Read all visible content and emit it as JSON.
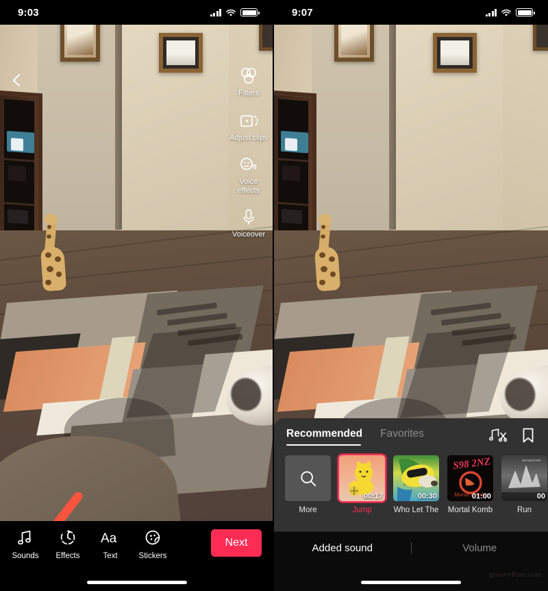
{
  "meta": {
    "watermark": "groovyPost.com"
  },
  "left_phone": {
    "status": {
      "time": "9:03",
      "signal_icon": "cellular-bars-icon",
      "wifi_icon": "wifi-icon",
      "battery_icon": "battery-icon"
    },
    "back_icon": "back-chevron-icon",
    "tools": [
      {
        "label": "Filters",
        "icon": "filters-icon"
      },
      {
        "label": "Adjust clips",
        "icon": "adjust-clips-icon"
      },
      {
        "label": "Voice effects",
        "icon": "voice-effects-icon"
      },
      {
        "label": "Voiceover",
        "icon": "microphone-icon"
      }
    ],
    "actions": [
      {
        "label": "Sounds",
        "icon": "music-note-icon"
      },
      {
        "label": "Effects",
        "icon": "effects-clock-icon"
      },
      {
        "label": "Text",
        "icon": "text-aa-icon"
      },
      {
        "label": "Stickers",
        "icon": "sticker-face-icon"
      }
    ],
    "next_label": "Next",
    "next_color": "#fe2c55",
    "annotation": {
      "icon": "red-arrow-icon",
      "color": "#f9543f",
      "points_to": "Sounds"
    }
  },
  "right_phone": {
    "status": {
      "time": "9:07",
      "signal_icon": "cellular-bars-icon",
      "wifi_icon": "wifi-icon",
      "battery_icon": "battery-icon"
    },
    "sound_panel": {
      "tabs": [
        {
          "label": "Recommended",
          "active": true
        },
        {
          "label": "Favorites",
          "active": false
        }
      ],
      "icons": [
        {
          "name": "trim-sound-icon"
        },
        {
          "name": "bookmark-icon"
        }
      ],
      "sounds": [
        {
          "name": "More",
          "duration": "",
          "selected": false,
          "art": "search"
        },
        {
          "name": "Jump",
          "duration": "00:17",
          "selected": true,
          "art": "cat"
        },
        {
          "name": "Who Let The",
          "duration": "00:30",
          "selected": false,
          "art": "dog"
        },
        {
          "name": "Mortal Komb",
          "duration": "01:00",
          "selected": false,
          "art": "mk"
        },
        {
          "name": "Run",
          "duration": "00",
          "selected": false,
          "art": "mono"
        }
      ],
      "bottom_tabs": [
        {
          "label": "Added sound",
          "active": true
        },
        {
          "label": "Volume",
          "active": false
        }
      ]
    }
  }
}
